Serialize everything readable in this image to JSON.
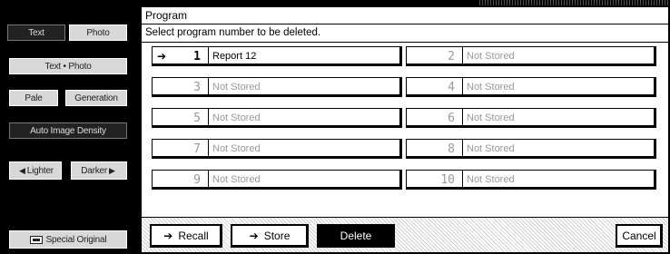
{
  "left_panel": {
    "text_label": "Text",
    "photo_label": "Photo",
    "text_photo_label": "Text • Photo",
    "pale_label": "Pale",
    "generation_label": "Generation",
    "auto_density_label": "Auto Image Density",
    "lighter_label": "Lighter",
    "darker_label": "Darker",
    "special_original_label": "Special Original"
  },
  "dialog": {
    "title": "Program",
    "subtitle": "Select program number to be deleted."
  },
  "programs": [
    {
      "number": "1",
      "name": "Report 12",
      "stored": true,
      "selected": true
    },
    {
      "number": "2",
      "name": "Not Stored",
      "stored": false
    },
    {
      "number": "3",
      "name": "Not Stored",
      "stored": false
    },
    {
      "number": "4",
      "name": "Not Stored",
      "stored": false
    },
    {
      "number": "5",
      "name": "Not Stored",
      "stored": false
    },
    {
      "number": "6",
      "name": "Not Stored",
      "stored": false
    },
    {
      "number": "7",
      "name": "Not Stored",
      "stored": false
    },
    {
      "number": "8",
      "name": "Not Stored",
      "stored": false
    },
    {
      "number": "9",
      "name": "Not Stored",
      "stored": false
    },
    {
      "number": "10",
      "name": "Not Stored",
      "stored": false
    }
  ],
  "actions": {
    "recall_label": "Recall",
    "store_label": "Store",
    "delete_label": "Delete",
    "cancel_label": "Cancel",
    "active": "delete"
  },
  "icons": {
    "pointer": "arrow-right-circle-icon",
    "lighter": "triangle-left-icon",
    "darker": "triangle-right-icon",
    "original": "original-document-icon"
  }
}
